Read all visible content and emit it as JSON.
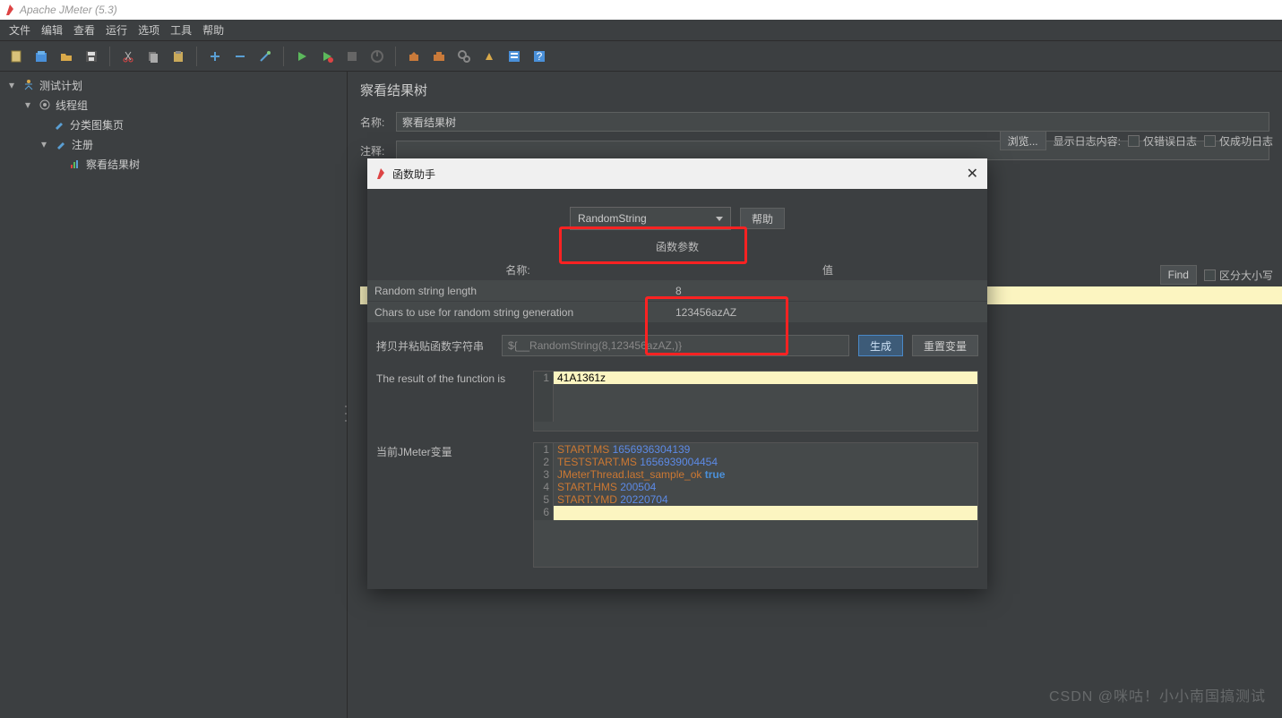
{
  "window": {
    "title": "Apache JMeter (5.3)"
  },
  "menu": [
    "文件",
    "编辑",
    "查看",
    "运行",
    "选项",
    "工具",
    "帮助"
  ],
  "tree": {
    "n0": "测试计划",
    "n1": "线程组",
    "n2": "分类图集页",
    "n3": "注册",
    "n4": "察看结果树"
  },
  "panel": {
    "title": "察看结果树",
    "name_label": "名称:",
    "name_value": "察看结果树",
    "comment_label": "注释:"
  },
  "rightopts": {
    "browse": "浏览...",
    "loglabel": "显示日志内容:",
    "errOnly": "仅错误日志",
    "okOnly": "仅成功日志"
  },
  "search": {
    "find": "Find",
    "case": "区分大小写"
  },
  "dialog": {
    "title": "函数助手",
    "select": "RandomString",
    "help": "帮助",
    "params_title": "函数参数",
    "col1": "名称:",
    "col2": "值",
    "rows": [
      {
        "name": "Random string length",
        "value": "8"
      },
      {
        "name": "Chars to use for random string generation",
        "value": "123456azAZ"
      }
    ],
    "copy_label": "拷贝并粘贴函数字符串",
    "copy_value": "${__RandomString(8,123456azAZ,)}",
    "generate": "生成",
    "reset": "重置变量",
    "result_label": "The result of the function is",
    "result_value": "41A1361z",
    "vars_label": "当前JMeter变量",
    "vars": [
      {
        "k": "START.MS",
        "v": "1656936304139"
      },
      {
        "k": "TESTSTART.MS",
        "v": "1656939004454"
      },
      {
        "k": "JMeterThread.last_sample_ok",
        "v": "true",
        "bool": true
      },
      {
        "k": "START.HMS",
        "v": "200504"
      },
      {
        "k": "START.YMD",
        "v": "20220704"
      }
    ]
  },
  "watermark": "CSDN @咪咕！小小南国搞测试"
}
